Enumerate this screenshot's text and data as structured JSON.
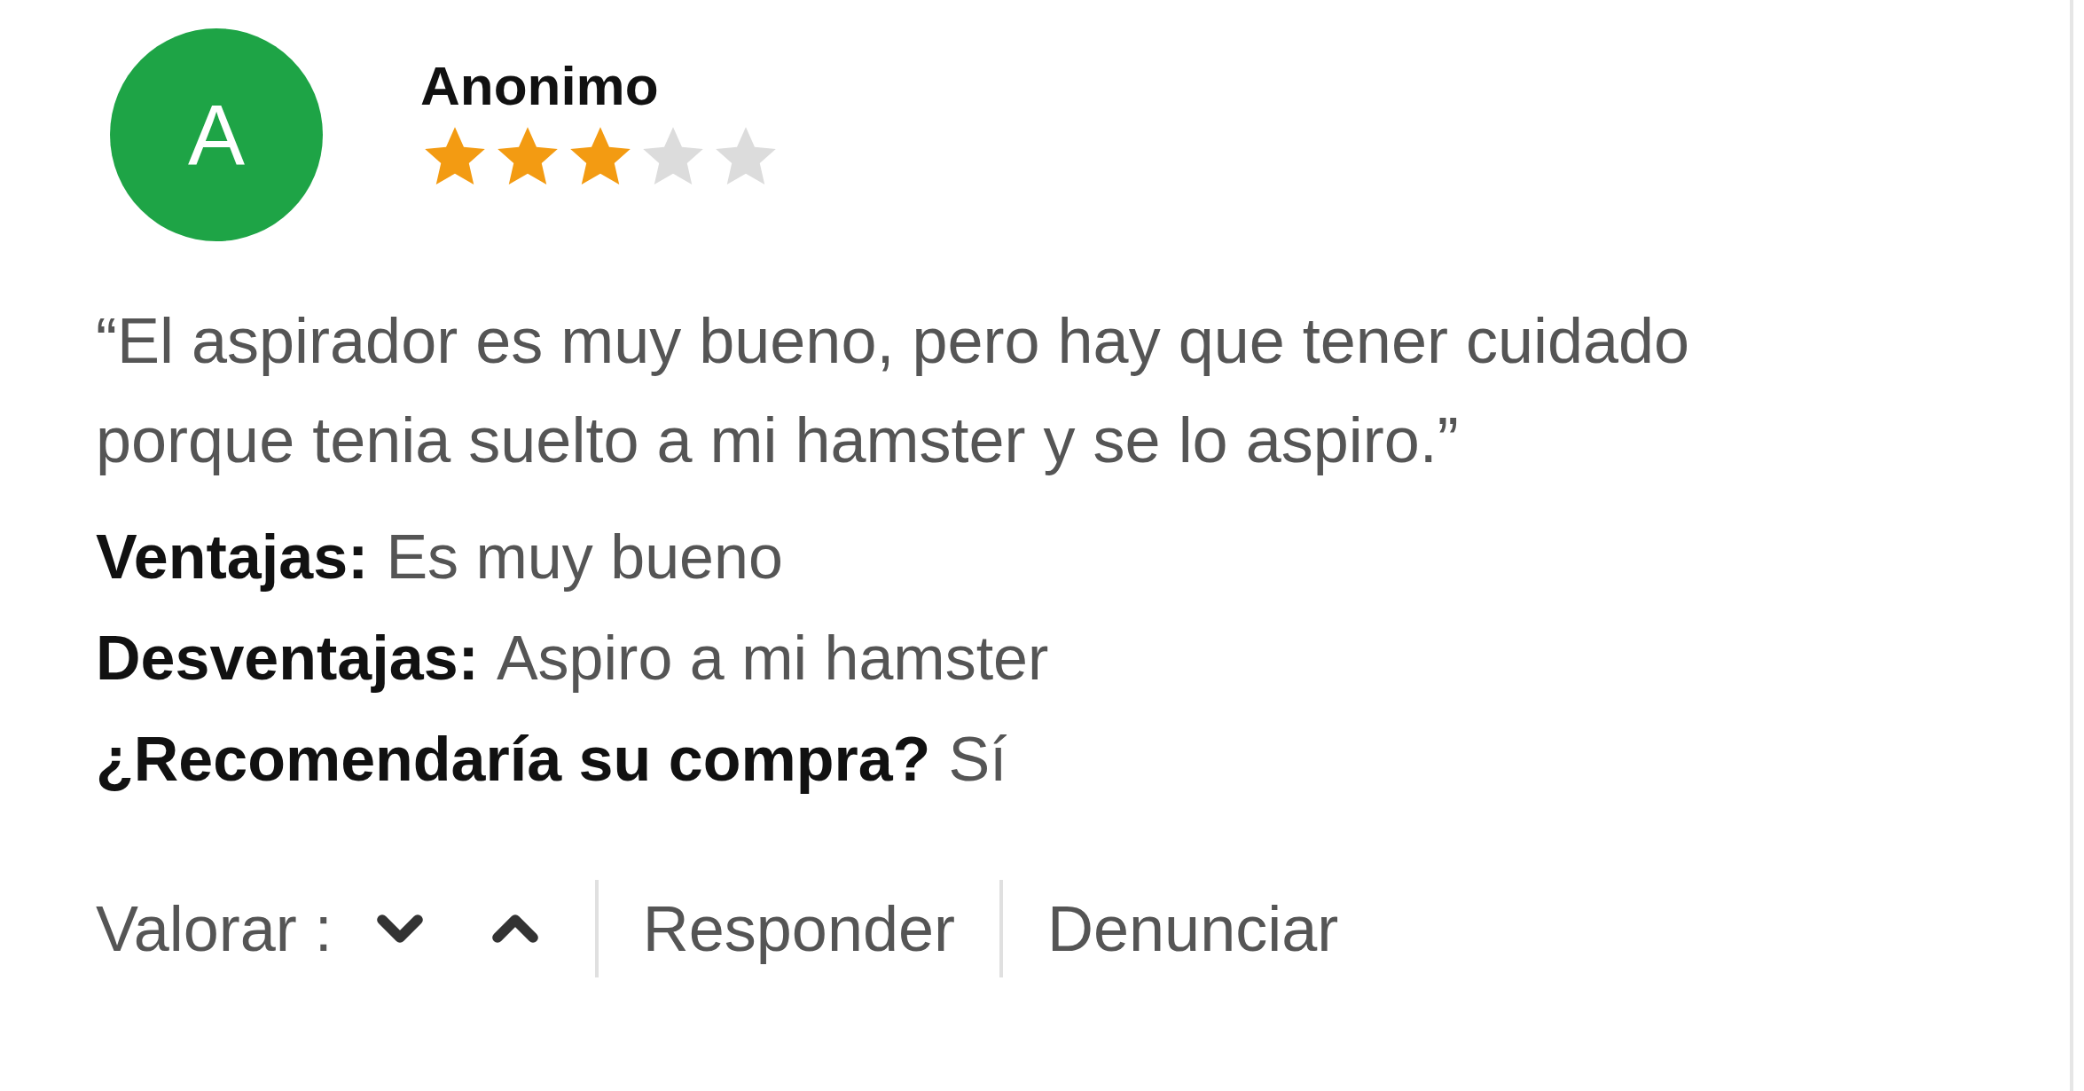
{
  "review": {
    "avatar_letter": "A",
    "author": "Anonimo",
    "stars": 3,
    "quote": "“El aspirador es muy bueno, pero hay que tener cuidado porque tenia suelto a mi hamster y se lo aspiro.”",
    "details": [
      {
        "label": "Ventajas:",
        "value": "Es muy bueno"
      },
      {
        "label": "Desventajas:",
        "value": "Aspiro a mi hamster"
      },
      {
        "label": "¿Recomendaría su compra?",
        "value": "Sí"
      }
    ],
    "actions": {
      "rate_label": "Valorar :",
      "links": [
        "Responder",
        "Denunciar"
      ]
    }
  }
}
